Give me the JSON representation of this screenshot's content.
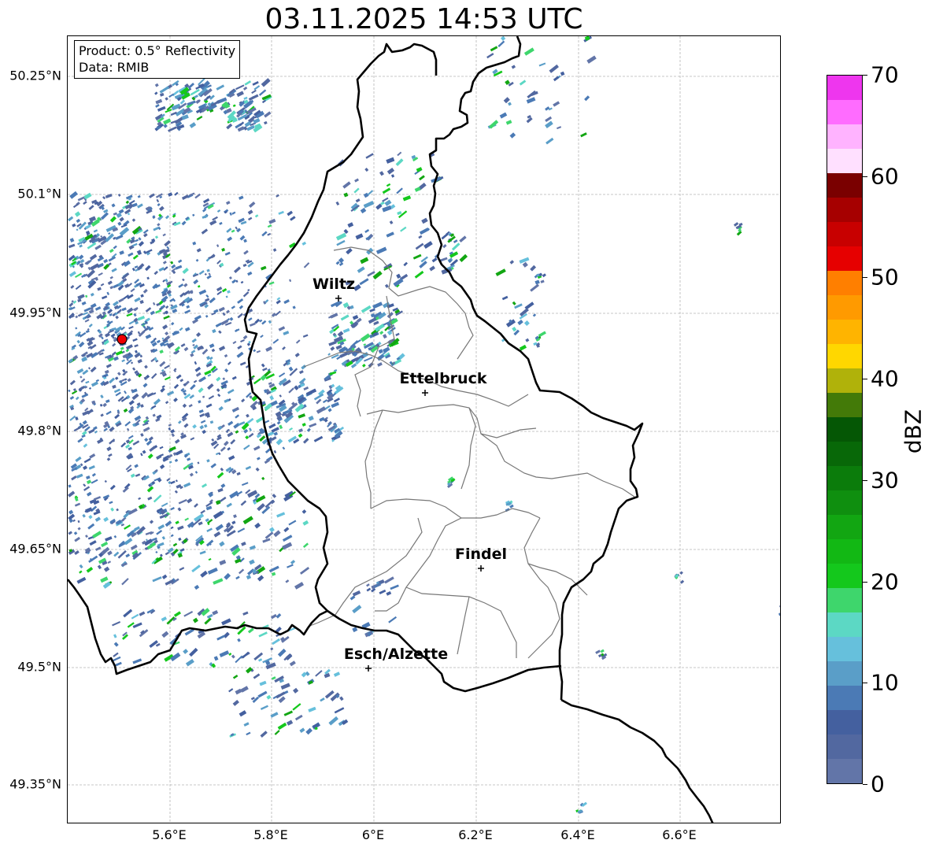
{
  "title": "03.11.2025 14:53 UTC",
  "info": {
    "product": "Product: 0.5° Reflectivity",
    "source": "Data: RMIB"
  },
  "axes": {
    "lat_labels": [
      "50.25°N",
      "50.1°N",
      "49.95°N",
      "49.8°N",
      "49.65°N",
      "49.5°N",
      "49.35°N"
    ],
    "lon_labels": [
      "5.6°E",
      "5.8°E",
      "6°E",
      "6.2°E",
      "6.4°E",
      "6.6°E"
    ]
  },
  "cities": [
    {
      "name": "Wiltz"
    },
    {
      "name": "Ettelbruck"
    },
    {
      "name": "Findel"
    },
    {
      "name": "Esch/Alzette"
    }
  ],
  "radar_site_color": "#ee0000",
  "colorbar": {
    "label": "dBZ",
    "min": 0,
    "max": 70,
    "ticks": [
      "0",
      "10",
      "20",
      "30",
      "40",
      "50",
      "60",
      "70"
    ],
    "colors": [
      "#6275a8",
      "#5268a0",
      "#44609f",
      "#4b7ab5",
      "#5a9ec8",
      "#66c0dc",
      "#5cd8c4",
      "#3ed66c",
      "#14c81c",
      "#12b814",
      "#12a612",
      "#0f8f0f",
      "#0b7c0b",
      "#086808",
      "#055705",
      "#437a08",
      "#b0b20a",
      "#ffd700",
      "#ffb400",
      "#ff9a00",
      "#ff7f00",
      "#e60000",
      "#c80000",
      "#a60000",
      "#7a0000",
      "#ffe0ff",
      "#ffb3ff",
      "#ff6cff",
      "#ee36ee"
    ]
  }
}
